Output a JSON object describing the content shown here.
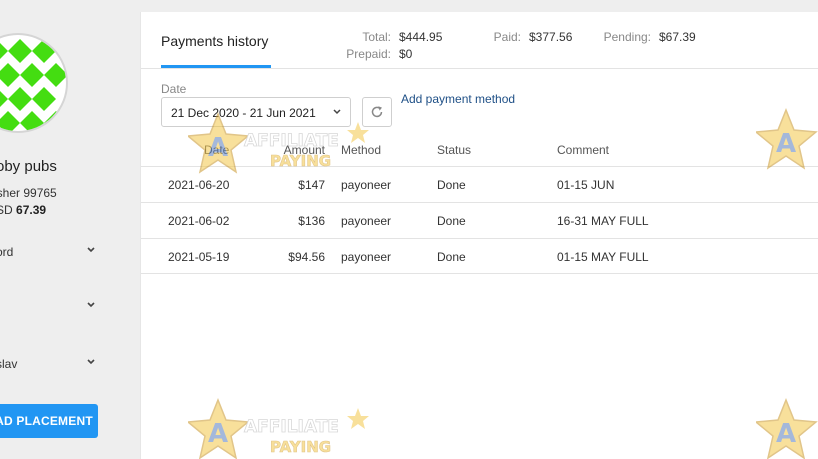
{
  "sidebar": {
    "user_name": "oby pubs",
    "publisher_text": "isher 99765",
    "balance_prefix": "SD ",
    "balance_value": "67.39",
    "menu": [
      {
        "label": "ord"
      },
      {
        "label": ""
      },
      {
        "label": "slav"
      }
    ],
    "add_placement_label": "AD PLACEMENT"
  },
  "main": {
    "tab_title": "Payments history",
    "summary": {
      "total_label": "Total:",
      "total_value": "$444.95",
      "prepaid_label": "Prepaid:",
      "prepaid_value": "$0",
      "paid_label": "Paid:",
      "paid_value": "$377.56",
      "pending_label": "Pending:",
      "pending_value": "$67.39"
    },
    "date_filter": {
      "label": "Date",
      "value": "21 Dec 2020 - 21 Jun 2021"
    },
    "add_payment_method_label": "Add payment method",
    "table": {
      "headers": {
        "date": "Date",
        "amount": "Amount",
        "method": "Method",
        "status": "Status",
        "comment": "Comment"
      },
      "rows": [
        {
          "date": "2021-06-20",
          "amount": "$147",
          "method": "payoneer",
          "status": "Done",
          "comment": "01-15 JUN"
        },
        {
          "date": "2021-06-02",
          "amount": "$136",
          "method": "payoneer",
          "status": "Done",
          "comment": "16-31 MAY FULL"
        },
        {
          "date": "2021-05-19",
          "amount": "$94.56",
          "method": "payoneer",
          "status": "Done",
          "comment": "01-15 MAY FULL"
        }
      ]
    }
  },
  "watermark": {
    "line1": "AFFILIATE",
    "line2": "PAYING"
  },
  "colors": {
    "accent": "#2196f3",
    "link": "#1e4f86",
    "avatar_green": "#44dd11"
  },
  "icons": {
    "chevron": "chevron-down-icon",
    "refresh": "refresh-icon",
    "avatar": "identicon-avatar"
  }
}
